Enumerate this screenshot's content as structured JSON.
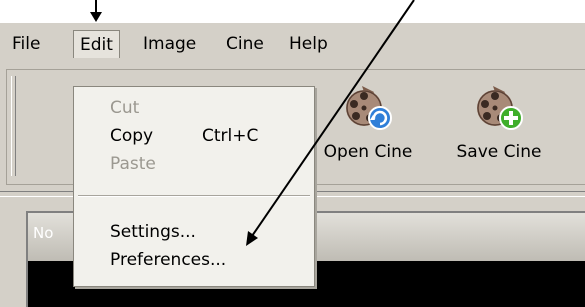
{
  "menubar": {
    "items": [
      {
        "label": "File"
      },
      {
        "label": "Edit"
      },
      {
        "label": "Image"
      },
      {
        "label": "Cine"
      },
      {
        "label": "Help"
      }
    ]
  },
  "edit_menu": {
    "items": [
      {
        "label": "Cut",
        "enabled": false
      },
      {
        "label": "Copy",
        "shortcut": "Ctrl+C",
        "enabled": true
      },
      {
        "label": "Paste",
        "enabled": false
      },
      {
        "label": "Settings...",
        "enabled": true
      },
      {
        "label": "Preferences...",
        "enabled": true
      }
    ]
  },
  "toolbar": {
    "buttons": [
      {
        "label": "Open Cine",
        "icon": "film-reel-open-icon",
        "badge_color": "#2f7fd8"
      },
      {
        "label": "Save Cine",
        "icon": "film-reel-save-icon",
        "badge_color": "#3fae2a"
      }
    ]
  },
  "panel": {
    "header_label": "No"
  },
  "annotations": {
    "arrow_color": "#000000"
  }
}
